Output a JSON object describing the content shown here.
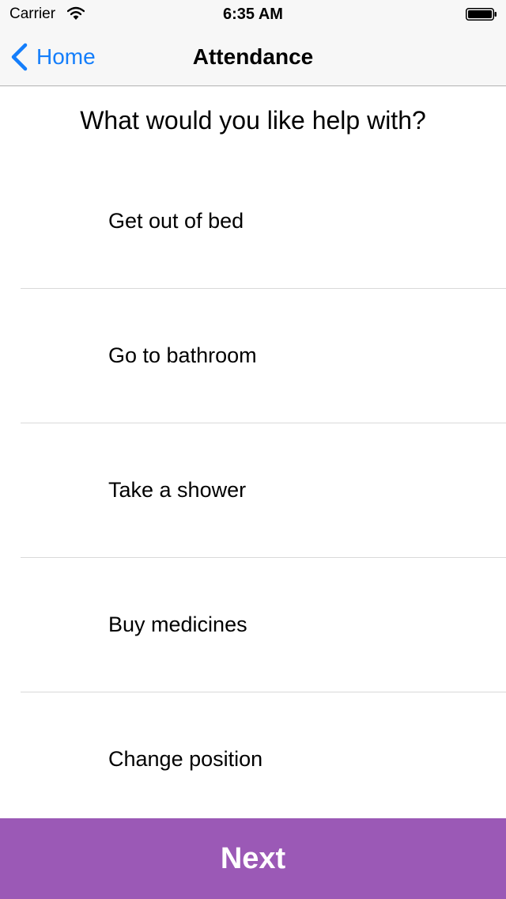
{
  "status_bar": {
    "carrier": "Carrier",
    "time": "6:35 AM",
    "wifi_icon": "wifi-icon",
    "battery_icon": "battery-icon"
  },
  "nav_bar": {
    "back_label": "Home",
    "back_icon": "chevron-left-icon",
    "title": "Attendance"
  },
  "question": "What would you like help with?",
  "options": [
    {
      "label": "Get out of bed"
    },
    {
      "label": "Go to bathroom"
    },
    {
      "label": "Take a shower"
    },
    {
      "label": "Buy medicines"
    },
    {
      "label": "Change position"
    }
  ],
  "next_button": {
    "label": "Next"
  },
  "colors": {
    "accent": "#147efb",
    "primary_button": "#9b59b6",
    "bar_background": "#f7f7f7",
    "separator": "#d9d9d9"
  }
}
